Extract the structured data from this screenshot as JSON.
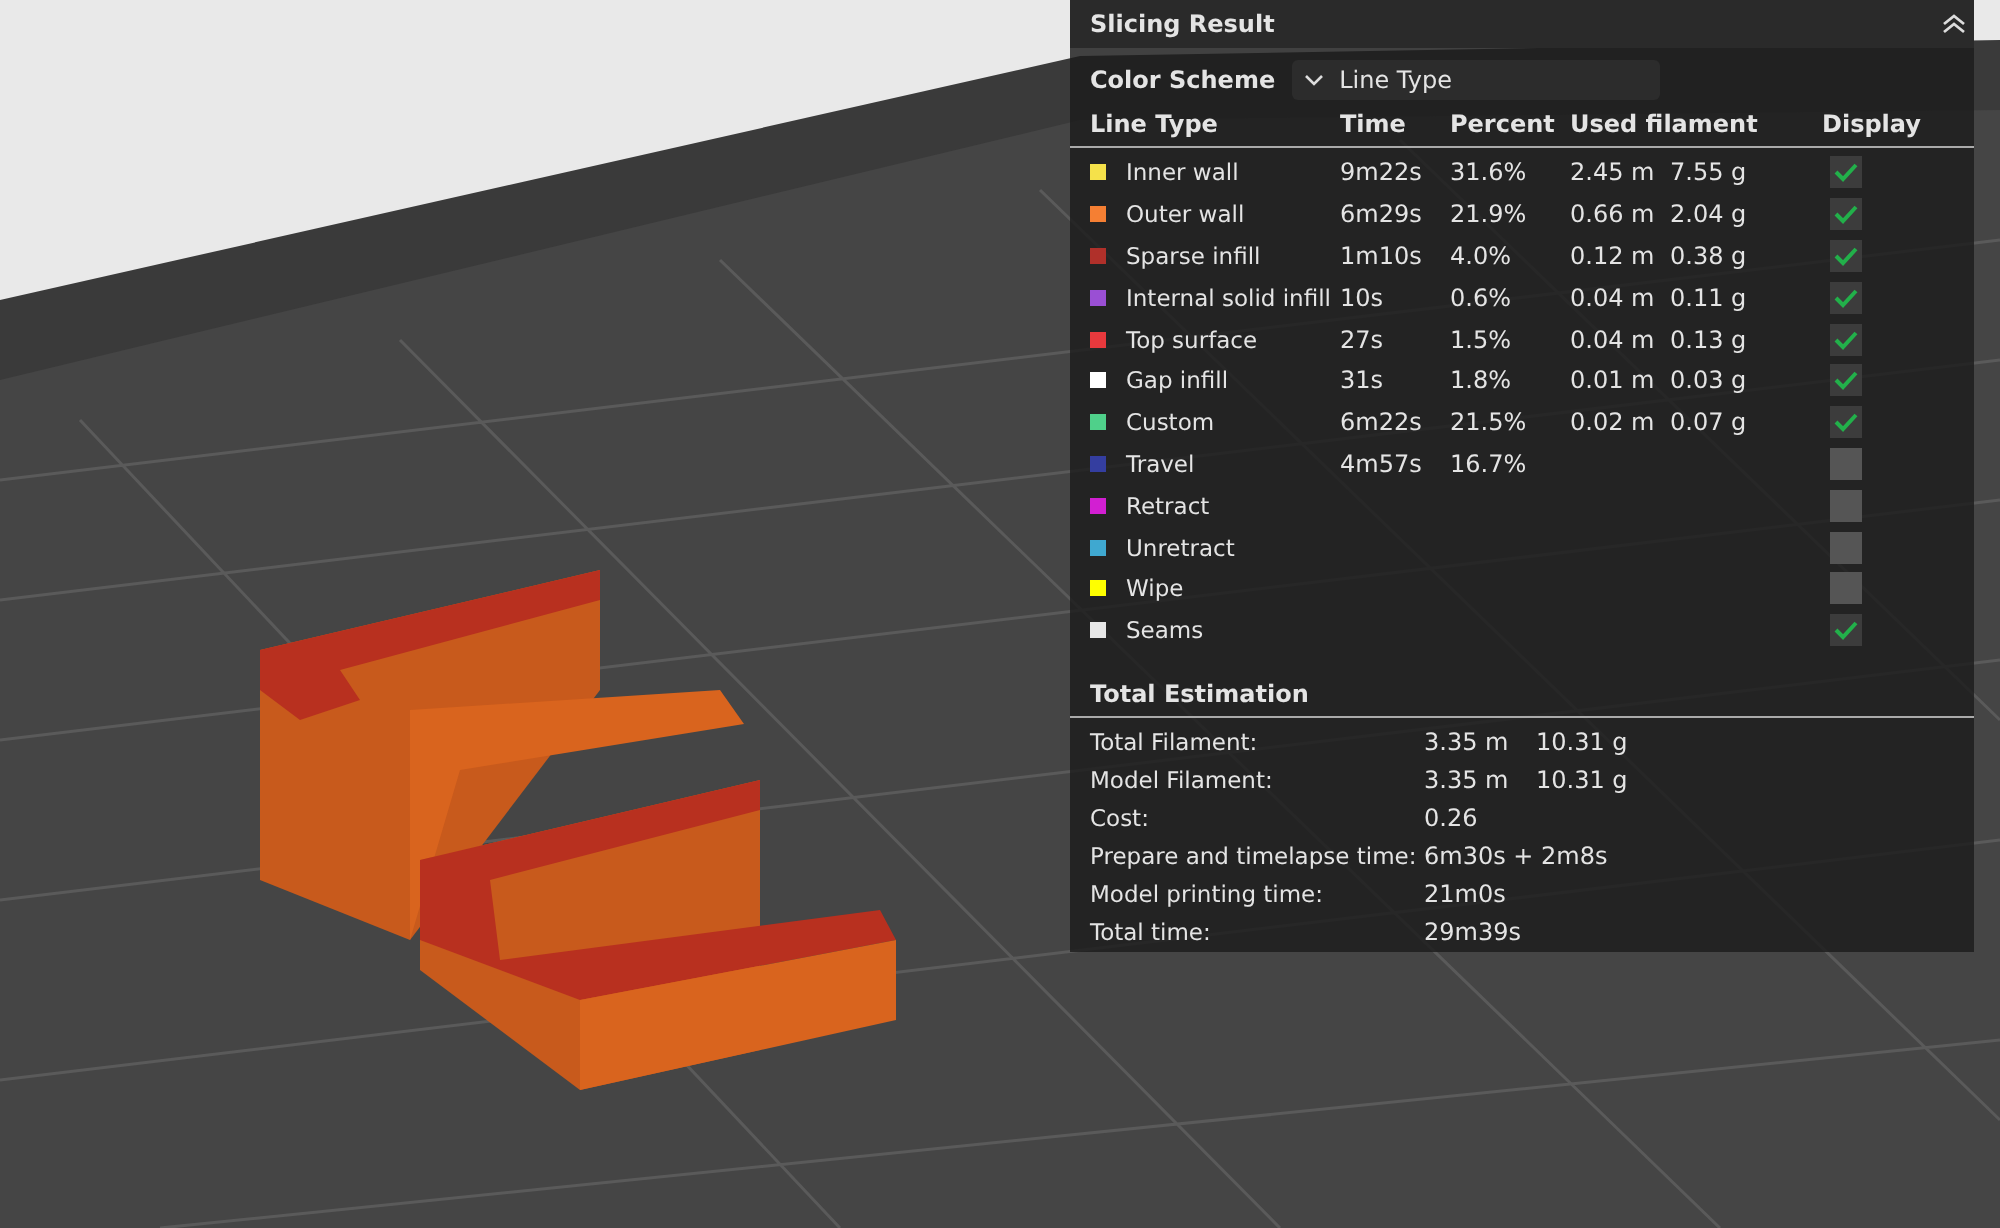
{
  "panel": {
    "title": "Slicing Result",
    "color_scheme": {
      "label": "Color Scheme",
      "value": "Line Type"
    },
    "columns": [
      "Line Type",
      "Time",
      "Percent",
      "Used filament",
      "Display"
    ],
    "rows": [
      {
        "name": "Inner wall",
        "color": "#f5e14a",
        "time": "9m22s",
        "percent": "31.6%",
        "length": "2.45 m",
        "weight": "7.55 g",
        "checked": true
      },
      {
        "name": "Outer wall",
        "color": "#f57f33",
        "time": "6m29s",
        "percent": "21.9%",
        "length": "0.66 m",
        "weight": "2.04 g",
        "checked": true
      },
      {
        "name": "Sparse infill",
        "color": "#b0302a",
        "time": "1m10s",
        "percent": "4.0%",
        "length": "0.12 m",
        "weight": "0.38 g",
        "checked": true
      },
      {
        "name": "Internal solid infill",
        "color": "#9a4fd4",
        "time": "10s",
        "percent": "0.6%",
        "length": "0.04 m",
        "weight": "0.11 g",
        "checked": true
      },
      {
        "name": "Top surface",
        "color": "#e8393d",
        "time": "27s",
        "percent": "1.5%",
        "length": "0.04 m",
        "weight": "0.13 g",
        "checked": true
      },
      {
        "name": "Gap infill",
        "color": "#ffffff",
        "time": "31s",
        "percent": "1.8%",
        "length": "0.01 m",
        "weight": "0.03 g",
        "checked": true
      },
      {
        "name": "Custom",
        "color": "#4fd08a",
        "time": "6m22s",
        "percent": "21.5%",
        "length": "0.02 m",
        "weight": "0.07 g",
        "checked": true
      },
      {
        "name": "Travel",
        "color": "#343ea0",
        "time": "4m57s",
        "percent": "16.7%",
        "checked": false
      },
      {
        "name": "Retract",
        "color": "#d21fd2",
        "checked": false
      },
      {
        "name": "Unretract",
        "color": "#3fa8d0",
        "checked": false
      },
      {
        "name": "Wipe",
        "color": "#ffff00",
        "checked": false
      },
      {
        "name": "Seams",
        "color": "#e6e6e6",
        "checked": true
      }
    ],
    "estimation": {
      "title": "Total Estimation",
      "items": [
        {
          "label": "Total Filament:",
          "values": [
            "3.35 m",
            "10.31 g"
          ]
        },
        {
          "label": "Model Filament:",
          "values": [
            "3.35 m",
            "10.31 g"
          ]
        },
        {
          "label": "Cost:",
          "values": [
            "0.26"
          ]
        },
        {
          "label": "Prepare and timelapse time:",
          "values": [
            "6m30s + 2m8s"
          ]
        },
        {
          "label": "Model printing time:",
          "values": [
            "21m0s"
          ]
        },
        {
          "label": "Total time:",
          "values": [
            "29m39s"
          ]
        }
      ]
    }
  }
}
